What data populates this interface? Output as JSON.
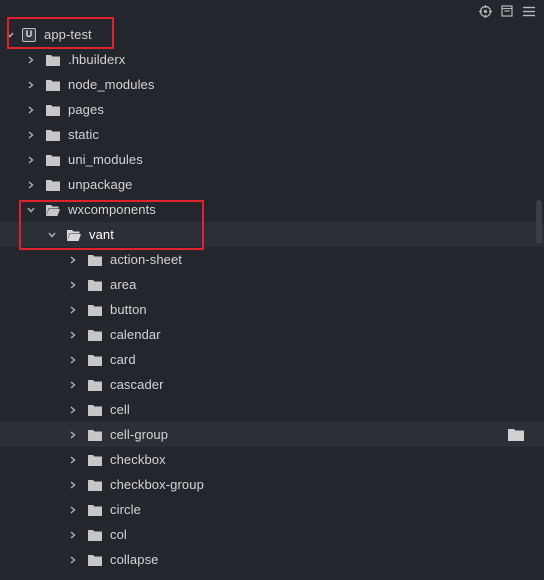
{
  "toolbar": {
    "icons": [
      "target-icon",
      "collapse-all-icon",
      "menu-icon"
    ]
  },
  "project": {
    "name": "app-test",
    "icon_letter": "U"
  },
  "tree": [
    {
      "label": ".hbuilderx",
      "expanded": false
    },
    {
      "label": "node_modules",
      "expanded": false
    },
    {
      "label": "pages",
      "expanded": false
    },
    {
      "label": "static",
      "expanded": false
    },
    {
      "label": "uni_modules",
      "expanded": false
    },
    {
      "label": "unpackage",
      "expanded": false
    },
    {
      "label": "wxcomponents",
      "expanded": true
    },
    {
      "label": "vant",
      "expanded": true
    },
    {
      "label": "action-sheet",
      "expanded": false
    },
    {
      "label": "area",
      "expanded": false
    },
    {
      "label": "button",
      "expanded": false
    },
    {
      "label": "calendar",
      "expanded": false
    },
    {
      "label": "card",
      "expanded": false
    },
    {
      "label": "cascader",
      "expanded": false
    },
    {
      "label": "cell",
      "expanded": false
    },
    {
      "label": "cell-group",
      "expanded": false
    },
    {
      "label": "checkbox",
      "expanded": false
    },
    {
      "label": "checkbox-group",
      "expanded": false
    },
    {
      "label": "circle",
      "expanded": false
    },
    {
      "label": "col",
      "expanded": false
    },
    {
      "label": "collapse",
      "expanded": false
    }
  ],
  "colors": {
    "background": "#24262d",
    "highlight_row": "#2c2f36",
    "annotation_box": "#e0232a",
    "text": "#d4d4d4"
  }
}
